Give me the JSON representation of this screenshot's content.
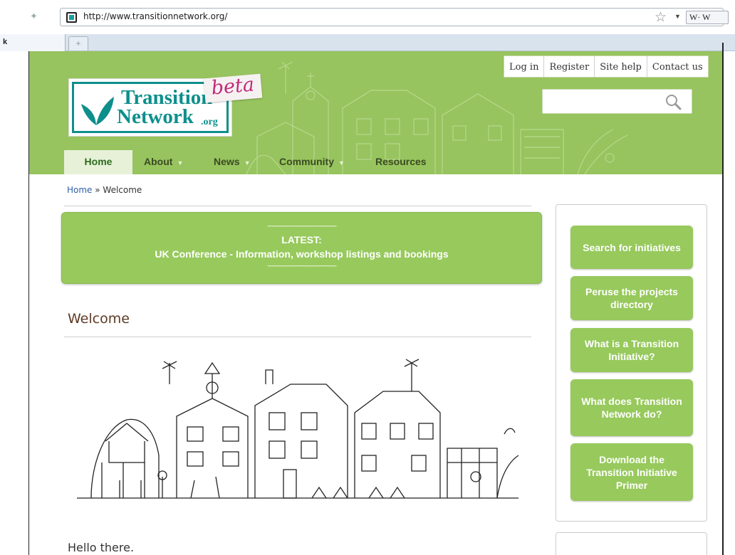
{
  "browser": {
    "url": "http://www.transitionnetwork.org/",
    "search_engine_label": "W· W",
    "tab_label": "k",
    "new_tab_label": "+"
  },
  "header": {
    "logo_line1": "Transition",
    "logo_line2": "Network",
    "logo_suffix": ".org",
    "beta_label": "beta",
    "utility_links": [
      "Log in",
      "Register",
      "Site help",
      "Contact us"
    ],
    "search_placeholder": ""
  },
  "nav": {
    "items": [
      "Home",
      "About",
      "News",
      "Community",
      "Resources"
    ]
  },
  "breadcrumb": {
    "home": "Home",
    "separator": " » ",
    "current": "Welcome"
  },
  "banner": {
    "tilde": "~~~~~~~~~~~~~~~~~~~~",
    "label": "LATEST:",
    "text": "UK Conference - Information, workshop listings and bookings"
  },
  "content": {
    "welcome_title": "Welcome",
    "hello_text": "Hello there."
  },
  "sidebar": {
    "buttons": [
      "Search for initiatives",
      "Peruse the projects directory",
      "What is a Transition Initiative?",
      "What does Transition Network do?",
      "Download the Transition Initiative Primer"
    ]
  },
  "colors": {
    "header_green": "#97c45e",
    "button_green": "#97c95c",
    "logo_teal": "#0d8f8c",
    "beta_magenta": "#c02a7a"
  }
}
